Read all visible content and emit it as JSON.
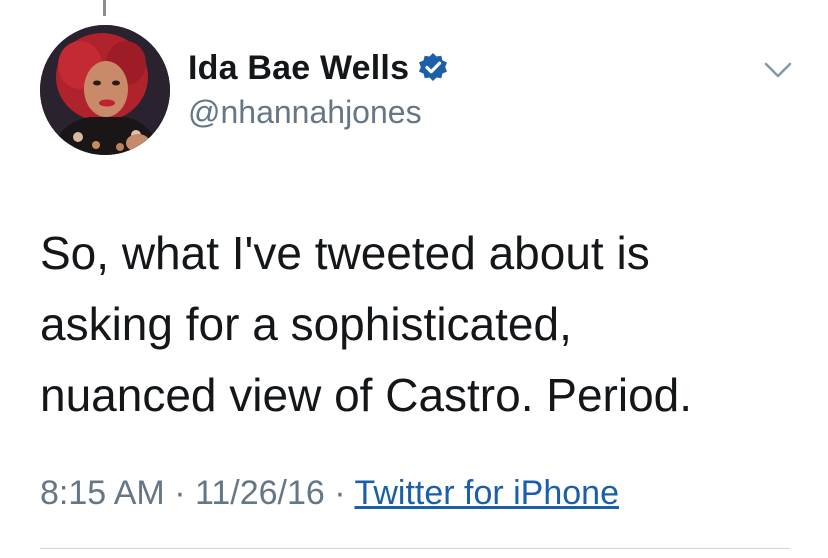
{
  "author": {
    "display_name": "Ida Bae Wells",
    "handle": "@nhannahjones",
    "verified": true,
    "avatar_icon": "profile-photo"
  },
  "tweet": {
    "text_lines": [
      "So, what I've tweeted about is",
      "asking for a sophisticated,",
      "nuanced view of Castro. Period."
    ]
  },
  "meta": {
    "time": "8:15 AM",
    "separator": "·",
    "date": "11/26/16",
    "source": "Twitter for iPhone"
  },
  "icons": {
    "menu": "chevron-down-icon",
    "verified": "verified-badge-icon"
  },
  "colors": {
    "text": "#14171a",
    "secondary": "#657786",
    "link": "#1b5fa8",
    "verified_blue": "#1d5ea8"
  }
}
